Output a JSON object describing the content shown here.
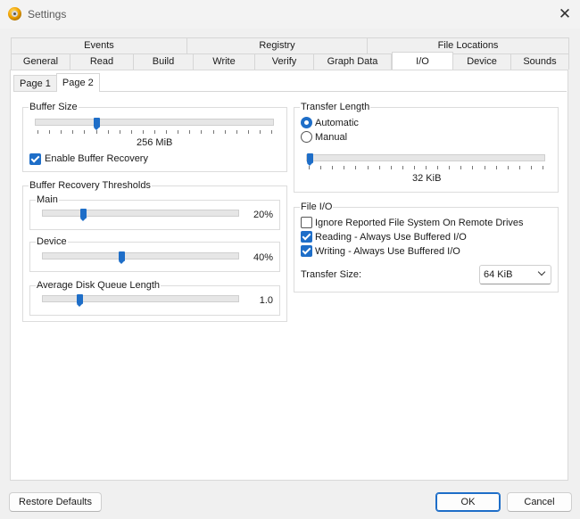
{
  "window": {
    "title": "Settings",
    "icon": "app-disc-icon"
  },
  "tabs": {
    "row_back": [
      "Events",
      "Registry",
      "File Locations"
    ],
    "row_front": [
      "General",
      "Read",
      "Build",
      "Write",
      "Verify",
      "Graph Data",
      "I/O",
      "Device",
      "Sounds"
    ],
    "active": "I/O"
  },
  "subtabs": {
    "items": [
      "Page 1",
      "Page 2"
    ],
    "active": "Page 2"
  },
  "buffer_size": {
    "legend": "Buffer Size",
    "value_label": "256 MiB",
    "position": 0.25,
    "recovery_label": "Enable Buffer Recovery",
    "recovery_checked": true
  },
  "buffer_recovery": {
    "legend": "Buffer Recovery Thresholds",
    "main": {
      "legend": "Main",
      "value_label": "20%",
      "position": 0.2
    },
    "device": {
      "legend": "Device",
      "value_label": "40%",
      "position": 0.4
    },
    "disk_queue": {
      "legend": "Average Disk Queue Length",
      "value_label": "1.0",
      "position": 0.18
    }
  },
  "transfer_length": {
    "legend": "Transfer Length",
    "automatic_label": "Automatic",
    "manual_label": "Manual",
    "selected": "Automatic",
    "value_label": "32 KiB",
    "position": 0.0
  },
  "file_io": {
    "legend": "File I/O",
    "ignore_label": "Ignore Reported File System On Remote Drives",
    "ignore_checked": false,
    "reading_label": "Reading - Always Use Buffered I/O",
    "reading_checked": true,
    "writing_label": "Writing - Always Use Buffered I/O",
    "writing_checked": true,
    "transfer_size_label": "Transfer Size:",
    "transfer_size_value": "64 KiB"
  },
  "buttons": {
    "restore": "Restore Defaults",
    "ok": "OK",
    "cancel": "Cancel"
  },
  "colors": {
    "accent": "#1e6ec8",
    "panel": "#ffffff",
    "window": "#f0f0f0"
  }
}
